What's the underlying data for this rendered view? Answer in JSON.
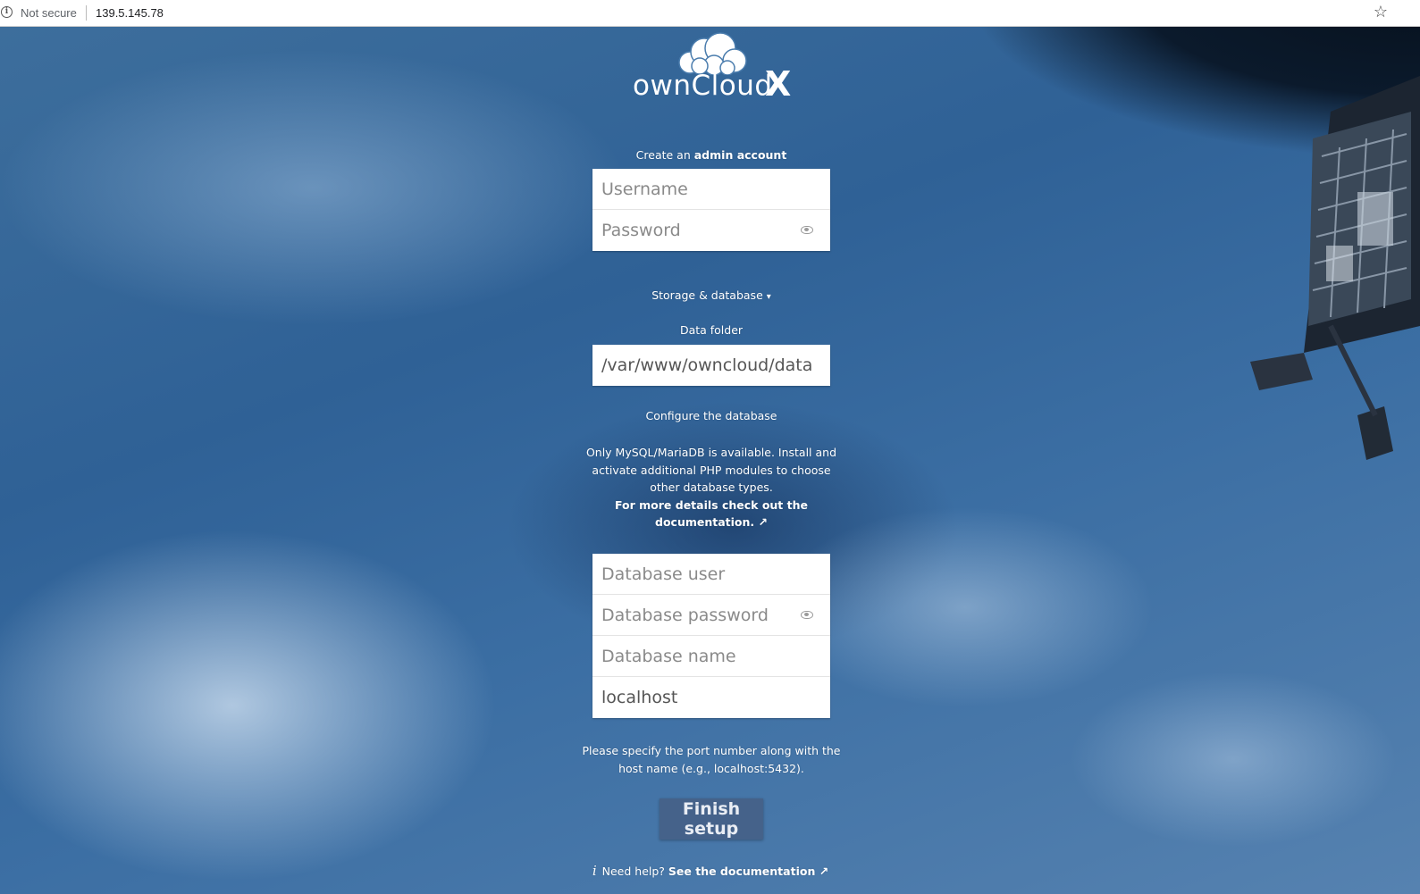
{
  "browser": {
    "security_label": "Not secure",
    "url": "139.5.145.78",
    "icons": {
      "info": "info-icon",
      "bookmark": "star-icon"
    }
  },
  "logo": {
    "brand": "ownCloud",
    "mark": "X"
  },
  "admin": {
    "heading_prefix": "Create an ",
    "heading_strong": "admin account",
    "username_placeholder": "Username",
    "password_placeholder": "Password"
  },
  "storage": {
    "toggle_label": "Storage & database",
    "toggle_arrow": "▾",
    "data_folder_label": "Data folder",
    "data_folder_value": "/var/www/owncloud/data"
  },
  "database": {
    "heading": "Configure the database",
    "info_line1": "Only MySQL/MariaDB is available. Install and",
    "info_line2": "activate additional PHP modules to choose",
    "info_line3": "other database types.",
    "info_link_line1": "For more details check out the",
    "info_link_line2": "documentation. ↗",
    "user_placeholder": "Database user",
    "password_placeholder": "Database password",
    "name_placeholder": "Database name",
    "host_value": "localhost",
    "port_hint_line1": "Please specify the port number along with the",
    "port_hint_line2": "host name (e.g., localhost:5432)."
  },
  "finish_button_label": "Finish setup",
  "help": {
    "icon": "i",
    "text": "Need help? ",
    "link": "See the documentation ↗"
  },
  "colors": {
    "button_bg": "#45628a",
    "background_blue": "#2f6196"
  }
}
